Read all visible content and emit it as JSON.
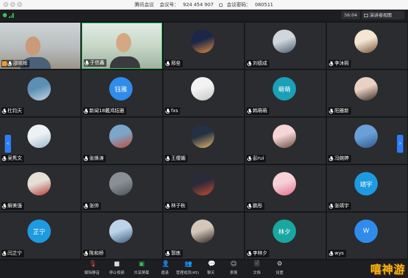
{
  "window": {
    "app_name": "腾讯会议",
    "meeting_id_label": "会议号：",
    "meeting_id": "924 454 907",
    "password_label": "会议密码：",
    "password": "080511"
  },
  "status": {
    "timer": "56:04",
    "speaker_view": "演讲者视图"
  },
  "participants": [
    {
      "name": "邵晓辉",
      "host": true,
      "avatar": {
        "type": "camera",
        "style": "a"
      }
    },
    {
      "name": "于信鑫",
      "host": false,
      "avatar": {
        "type": "camera",
        "style": "b"
      },
      "active": true
    },
    {
      "name": "邢垒",
      "avatar": {
        "type": "photo",
        "colors": [
          "#1c2747",
          "#e08a3c"
        ]
      }
    },
    {
      "name": "刘德成",
      "avatar": {
        "type": "photo",
        "colors": [
          "#d0d6dc",
          "#4a5a6a"
        ]
      }
    },
    {
      "name": "李沐熙",
      "avatar": {
        "type": "photo",
        "colors": [
          "#f3e7d3",
          "#7a5238"
        ]
      }
    },
    {
      "name": "杜钧天",
      "avatar": {
        "type": "photo",
        "colors": [
          "#5c8fb5",
          "#c3d5e2"
        ]
      }
    },
    {
      "name": "新闻18戴鸿钰雅",
      "avatar": {
        "type": "text",
        "text": "钰雅",
        "color": "#2f8ceb"
      }
    },
    {
      "name": "fxs",
      "avatar": {
        "type": "photo",
        "colors": [
          "#f2f2f2",
          "#c6c6c6"
        ]
      }
    },
    {
      "name": "韩萌萌",
      "avatar": {
        "type": "text",
        "text": "萌萌",
        "color": "#1aa0b8"
      }
    },
    {
      "name": "阳雅新",
      "avatar": {
        "type": "photo",
        "colors": [
          "#e9d2c3",
          "#3b2a26"
        ]
      }
    },
    {
      "name": "吴隽文",
      "avatar": {
        "type": "photo",
        "colors": [
          "#eef1f3",
          "#9cb8cc"
        ]
      }
    },
    {
      "name": "张焕涛",
      "avatar": {
        "type": "photo",
        "colors": [
          "#7ba6c9",
          "#c64a3a"
        ]
      }
    },
    {
      "name": "王缨媚",
      "avatar": {
        "type": "photo",
        "colors": [
          "#243142",
          "#e4b66a"
        ]
      }
    },
    {
      "name": "彭rui",
      "avatar": {
        "type": "photo",
        "colors": [
          "#f4d5d8",
          "#6a4b3b"
        ]
      }
    },
    {
      "name": "冯婉婷",
      "avatar": {
        "type": "photo",
        "colors": [
          "#6aa0d8",
          "#2d5a8a"
        ]
      }
    },
    {
      "name": "解美强",
      "avatar": {
        "type": "photo",
        "colors": [
          "#e4e0d8",
          "#b23a33"
        ]
      }
    },
    {
      "name": "张帅",
      "avatar": {
        "type": "photo",
        "colors": [
          "#8a8f96",
          "#4d535b"
        ]
      }
    },
    {
      "name": "林子秋",
      "avatar": {
        "type": "photo",
        "colors": [
          "#2a2a3a",
          "#c94c2f"
        ]
      }
    },
    {
      "name": "鹏彤",
      "avatar": {
        "type": "photo",
        "colors": [
          "#f6d1d8",
          "#e56f8c"
        ]
      }
    },
    {
      "name": "张靖宇",
      "avatar": {
        "type": "text",
        "text": "靖宇",
        "color": "#1e9be0"
      }
    },
    {
      "name": "闫芷宁",
      "avatar": {
        "type": "text",
        "text": "芷宁",
        "color": "#1e9be0"
      }
    },
    {
      "name": "陈和桥",
      "avatar": {
        "type": "photo",
        "colors": [
          "#bdd4e8",
          "#3b5c7c"
        ]
      }
    },
    {
      "name": "郭炼",
      "avatar": {
        "type": "photo",
        "colors": [
          "#d4c6b8",
          "#2d2522"
        ]
      }
    },
    {
      "name": "李林夕",
      "avatar": {
        "type": "text",
        "text": "林夕",
        "color": "#18a7a1"
      }
    },
    {
      "name": "wys",
      "avatar": {
        "type": "text",
        "text": "W",
        "color": "#2f8ceb"
      }
    }
  ],
  "toolbar": [
    {
      "label": "解除静音",
      "icon": "mic-muted-icon",
      "glyph": "🎙",
      "tone": "red"
    },
    {
      "label": "停止视频",
      "icon": "video-icon",
      "glyph": "■",
      "tone": ""
    },
    {
      "label": "共享屏幕",
      "icon": "share-screen-icon",
      "glyph": "▣",
      "tone": "green"
    },
    {
      "label": "邀请",
      "icon": "invite-icon",
      "glyph": "👤",
      "tone": ""
    },
    {
      "label": "管理成员(45)",
      "icon": "members-icon",
      "glyph": "👥",
      "tone": ""
    },
    {
      "label": "聊天",
      "icon": "chat-icon",
      "glyph": "💬",
      "tone": ""
    },
    {
      "label": "表情",
      "icon": "emoji-icon",
      "glyph": "☺",
      "tone": ""
    },
    {
      "label": "文档",
      "icon": "document-icon",
      "glyph": "🗎",
      "tone": ""
    },
    {
      "label": "设置",
      "icon": "settings-icon",
      "glyph": "⚙",
      "tone": ""
    }
  ],
  "watermark": "嘻神游"
}
